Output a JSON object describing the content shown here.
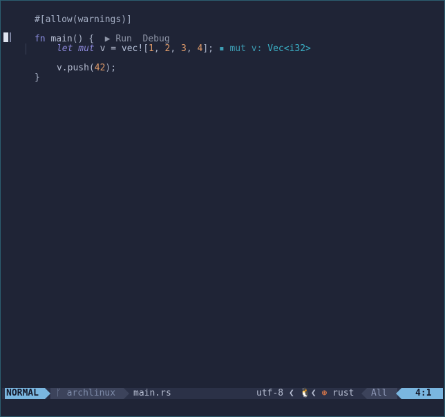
{
  "editor": {
    "line1": "#[allow(warnings)]",
    "line3": {
      "kw": "fn",
      "name": " main",
      "punc": "() {",
      "lens_run": "Run",
      "lens_debug": "Debug"
    },
    "line4": {
      "let": "let",
      "mut": "mut",
      "var": " v = ",
      "macro": "vec!",
      "open": "[",
      "n1": "1",
      "c1": ", ",
      "n2": "2",
      "c2": ", ",
      "n3": "3",
      "c3": ", ",
      "n4": "4",
      "close": "];",
      "hint_bullet": "▪",
      "hint_label": " mut v: ",
      "hint_type": "Vec<i32>"
    },
    "line6": {
      "pre": "v.push(",
      "num": "42",
      "post": ");"
    },
    "line7": "}"
  },
  "status": {
    "mode": "NORMAL",
    "branch_icon": "git-branch-icon",
    "branch": "archlinux",
    "file": "main.rs",
    "encoding": "utf-8",
    "tux_icon": "🐧",
    "rust_icon": "⊛",
    "filetype": "rust",
    "scroll": "All",
    "position": "4:1"
  },
  "colors": {
    "background": "#1f2436",
    "mode_accent": "#7ab6e0",
    "number": "#e09b6a",
    "keyword": "#8d8fe3",
    "type_hint": "#3bb0c6"
  }
}
